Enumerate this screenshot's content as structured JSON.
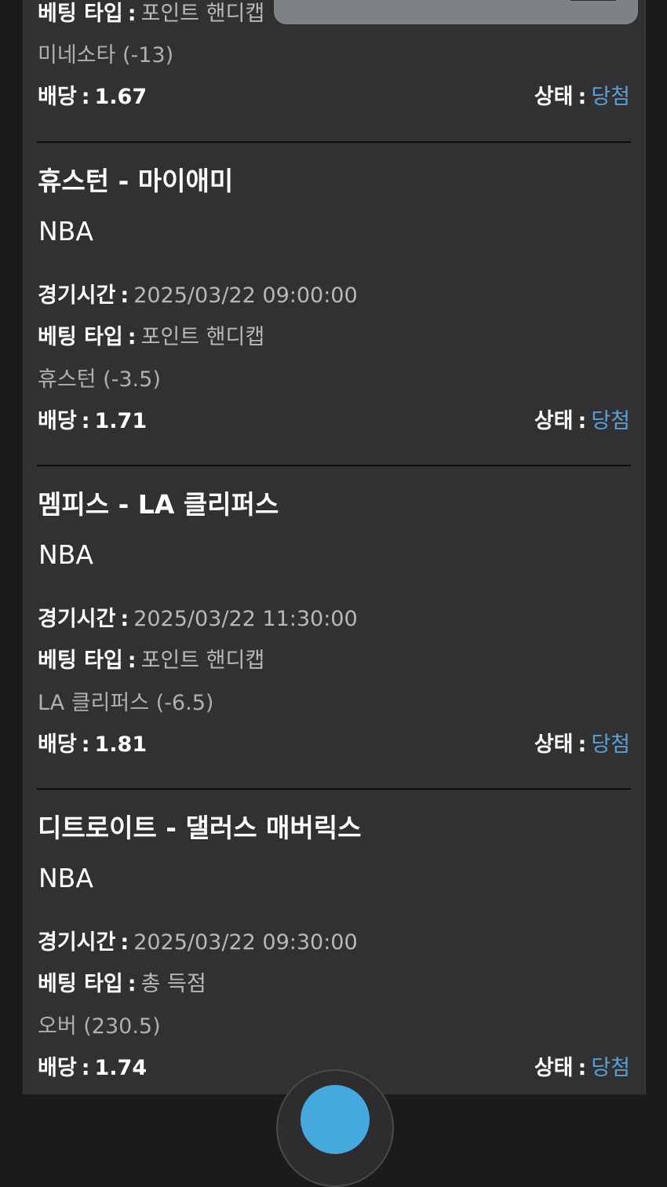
{
  "labels": {
    "game_time": "경기시간",
    "bet_type": "베팅 타입",
    "odds": "배당",
    "status": "상태",
    "colon": ":"
  },
  "bets": [
    {
      "bet_type": "포인트 핸디캡",
      "pick": "미네소타 (-13)",
      "odds": "1.67",
      "status": "당첨"
    },
    {
      "match": "휴스턴 - 마이애미",
      "league": "NBA",
      "time": "2025/03/22 09:00:00",
      "bet_type": "포인트 핸디캡",
      "pick": "휴스턴 (-3.5)",
      "odds": "1.71",
      "status": "당첨"
    },
    {
      "match": "멤피스 - LA 클리퍼스",
      "league": "NBA",
      "time": "2025/03/22 11:30:00",
      "bet_type": "포인트 핸디캡",
      "pick": "LA 클리퍼스 (-6.5)",
      "odds": "1.81",
      "status": "당첨"
    },
    {
      "match": "디트로이트 - 댈러스 매버릭스",
      "league": "NBA",
      "time": "2025/03/22 09:30:00",
      "bet_type": "총 득점",
      "pick": "오버 (230.5)",
      "odds": "1.74",
      "status": "당첨"
    }
  ],
  "colors": {
    "background": "#1b1b1d",
    "panel": "#313032",
    "status_won": "#5aa0d6",
    "fab": "#45a9dd"
  }
}
